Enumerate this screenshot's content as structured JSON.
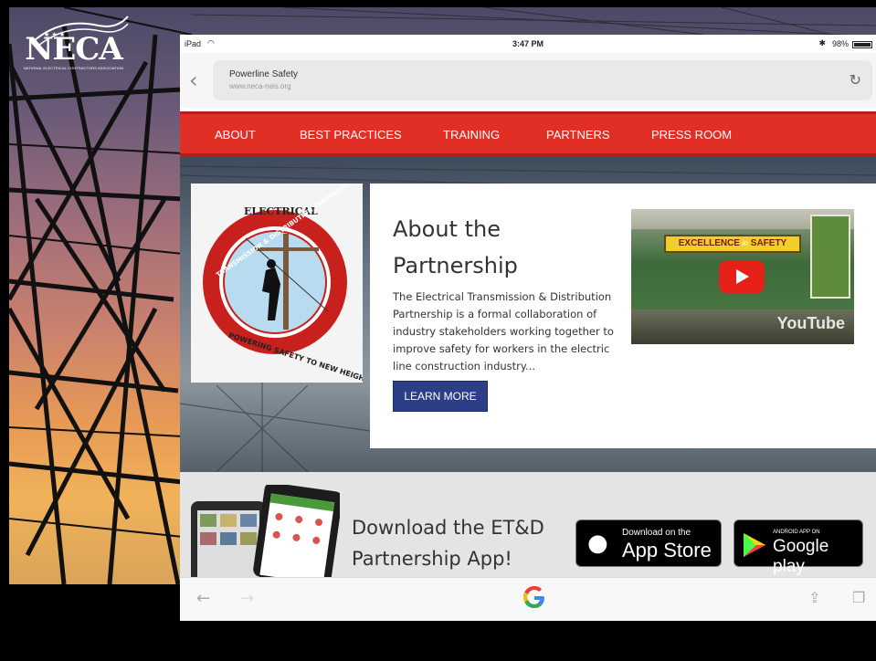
{
  "logo": {
    "name": "NECA",
    "tagline": "NATIONAL ELECTRICAL CONTRACTORS ASSOCIATION"
  },
  "status_bar": {
    "device": "iPad",
    "time": "3:47 PM",
    "battery": "98%"
  },
  "browser": {
    "page_title": "Powerline Safety",
    "url": "www.neca-neis.org"
  },
  "nav": {
    "items": [
      "ABOUT",
      "BEST PRACTICES",
      "TRAINING",
      "PARTNERS",
      "PRESS ROOM"
    ]
  },
  "about": {
    "heading": "About the Partnership",
    "body": "The Electrical Transmission & Distribution Partnership is a formal collaboration of industry stakeholders working together to improve safety for workers in the electric line construction industry...",
    "button": "LEARN MORE"
  },
  "partnership_logo": {
    "top_text": "ELECTRICAL",
    "ring_text": "TRANSMISSION & DISTRIBUTION PARTNERSHIP",
    "bottom_text": "POWERING SAFETY TO NEW HEIGHTS"
  },
  "video": {
    "banner_a": "EXCELLENCE",
    "banner_in": "in",
    "banner_b": "SAFETY",
    "provider": "YouTube"
  },
  "app": {
    "text": "Download the ET&D Partnership App!",
    "appstore_small": "Download on the",
    "appstore_big": "App Store",
    "googleplay_small": "ANDROID APP ON",
    "googleplay_big": "Google play"
  },
  "colors": {
    "nav_red": "#e22f26",
    "button_blue": "#2b3e86"
  }
}
